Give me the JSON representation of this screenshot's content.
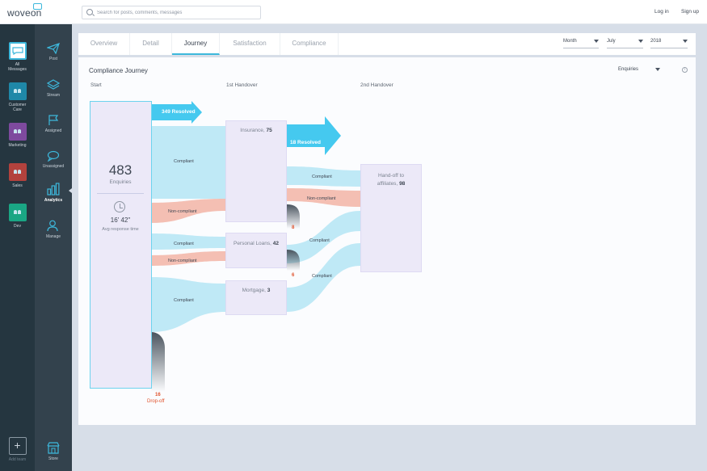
{
  "app": {
    "logo": "woveon"
  },
  "search": {
    "placeholder": "Search for posts, comments, messages"
  },
  "auth": {
    "login": "Log in",
    "signup": "Sign up"
  },
  "teams": [
    {
      "label_1": "All",
      "label_2": "Messages",
      "color": "#ffffff"
    },
    {
      "label_1": "Customer",
      "label_2": "Care",
      "color": "#1f88a8"
    },
    {
      "label_1": "Marketing",
      "label_2": "",
      "color": "#7e4a9e"
    },
    {
      "label_1": "Sales",
      "label_2": "",
      "color": "#b3423d"
    },
    {
      "label_1": "Dev",
      "label_2": "",
      "color": "#1aa684"
    }
  ],
  "add_team": "Add team",
  "nav": {
    "post": "Post",
    "stream": "Stream",
    "assigned": "Assigned",
    "unassigned": "Unassigned",
    "analytics": "Analytics",
    "manage": "Manage",
    "store": "Store"
  },
  "tabs": [
    "Overview",
    "Detail",
    "Journey",
    "Satisfaction",
    "Compliance"
  ],
  "filters": {
    "period": "Month",
    "month": "July",
    "year": "2018"
  },
  "card": {
    "title": "Compliance Journey",
    "metric": "Enquiries"
  },
  "columns": {
    "start": "Start",
    "first": "1st Handover",
    "second": "2nd Handover"
  },
  "start_node": {
    "count": "483",
    "count_label": "Enquiries",
    "time": "16' 42\"",
    "time_label": "Avg response time"
  },
  "nodes": {
    "insurance": {
      "label": "Insurance,",
      "value": "75"
    },
    "loans": {
      "label": "Personal Loans,",
      "value": "42"
    },
    "mortgage": {
      "label": "Mortgage,",
      "value": "3"
    },
    "affiliates": {
      "label": "Hand-off to",
      "label2": "affiliates,",
      "value": "98"
    }
  },
  "flows": {
    "resolved_1": "349 Resolved",
    "resolved_2": "18 Resolved",
    "compliant": "Compliant",
    "noncompliant": "Non-compliant",
    "drop_insurance": "8",
    "drop_loans": "6",
    "drop_start": "16",
    "dropoff": "Drop-off"
  },
  "colors": {
    "accent": "#3db8dc",
    "compliant": "#bfe9f6",
    "noncompliant": "#f4bfb3",
    "resolved": "#45c9ef",
    "node": "#ece9f8"
  }
}
